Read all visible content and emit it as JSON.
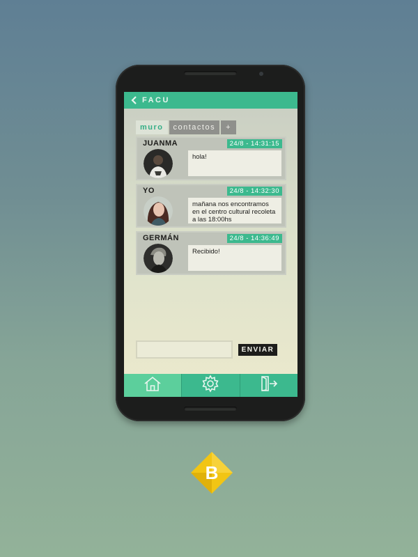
{
  "app": {
    "title": "FACU"
  },
  "tabs": [
    {
      "label": "muro",
      "active": true
    },
    {
      "label": "contactos",
      "active": false
    },
    {
      "label": "+",
      "active": false
    }
  ],
  "posts": [
    {
      "name": "JUANMA",
      "time": "24/8 - 14:31:15",
      "message": "hola!",
      "avatar": "avatar-juanma"
    },
    {
      "name": "YO",
      "time": "24/8 - 14:32:30",
      "message": "mañana nos encontramos en el centro cultural recoleta a las 18:00hs",
      "avatar": "avatar-yo"
    },
    {
      "name": "GERMÁN",
      "time": "24/8 - 14:36:49",
      "message": "Recibido!",
      "avatar": "avatar-german"
    }
  ],
  "composer": {
    "input_value": "",
    "placeholder": "",
    "send_label": "ENVIAR"
  },
  "bottom_nav": [
    {
      "icon": "home-icon",
      "active": true
    },
    {
      "icon": "gear-icon",
      "active": false
    },
    {
      "icon": "logout-icon",
      "active": false
    }
  ],
  "brand_logo": {
    "letter": "B",
    "icon": "brand-logo-icon"
  },
  "colors": {
    "accent": "#3cb98e",
    "accent_light": "#5ccf9c",
    "dark": "#1d1d1b",
    "logo_yellow": "#f2c514"
  }
}
